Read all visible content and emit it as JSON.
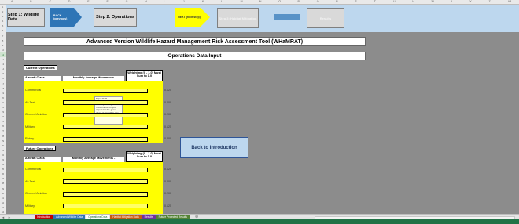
{
  "column_headers": [
    "A",
    "B",
    "C",
    "D",
    "E",
    "F",
    "G",
    "H",
    "I",
    "J",
    "K",
    "L",
    "M",
    "N",
    "O",
    "P",
    "Q",
    "R",
    "S",
    "T",
    "U",
    "V",
    "W",
    "X",
    "Y",
    "Z",
    "AA"
  ],
  "row_numbers": [
    "1",
    "2",
    "3",
    "4",
    "5",
    "6",
    "7",
    "8",
    "9",
    "10",
    "11",
    "12",
    "13",
    "14",
    "15",
    "16",
    "17",
    "18",
    "19",
    "20",
    "21",
    "22",
    "23",
    "24",
    "25",
    "26",
    "27",
    "28",
    "29",
    "30",
    "31",
    "32",
    "33",
    "34",
    "35",
    "36",
    "37",
    "38",
    "39",
    "40",
    "41",
    "42",
    "43",
    "44"
  ],
  "nav": {
    "step1": "Step 1: Wildlife Data",
    "back_arrow": "BACK (previous)",
    "step2": "Step 2: Operations",
    "next_arrow": "NEXT (next step)",
    "step3": "Step 3: Habitat Mitigation",
    "results": "Results",
    "colors": {
      "band": "#bdd7ee",
      "back_arrow": "#2e75b6",
      "next_arrow": "#ffff00"
    }
  },
  "title": "Advanced Version Wildlife Hazard Management Risk Assessment Tool (WHaMRAT)",
  "subtitle": "Operations Data Input",
  "current": {
    "label": "Current Operations",
    "col_class": "Aircraft Class",
    "col_movements": "Monthly Average Movements",
    "col_weight": "Weighting (0 - 1.0) Must Sum to 1.0",
    "rows": [
      {
        "cls": "Commercial",
        "weight": "0.125"
      },
      {
        "cls": "Air Taxi",
        "weight": "0.200"
      },
      {
        "cls": "General Aviation",
        "weight": "0.200"
      },
      {
        "cls": "Military",
        "weight": "0.125"
      },
      {
        "cls": "Rotary",
        "weight": "0.200"
      }
    ]
  },
  "future": {
    "label": "Future Operations",
    "col_class": "Aircraft Class",
    "col_movements": "Monthly Average Movements -",
    "col_weight": "Weighting (0 - 1.0) Must Sum to 1.0",
    "rows": [
      {
        "cls": "Commercial",
        "weight": "0.125"
      },
      {
        "cls": "Air Taxi",
        "weight": "0.200"
      },
      {
        "cls": "General Aviation",
        "weight": "0.200"
      },
      {
        "cls": "Military",
        "weight": "0.125"
      }
    ]
  },
  "tooltip": {
    "title": "Input Cell",
    "body": "Enter the number of monthly average movements for your airport for the given class of aircraft in this cell."
  },
  "back_to_intro": "Back to Introduction",
  "tabs": [
    {
      "label": "Introduction",
      "color": "#c00000"
    },
    {
      "label": "Advanced Wildlife Data",
      "color": "#2e75b6"
    },
    {
      "label": "Operations Data",
      "color": "#ffffff",
      "active": true
    },
    {
      "label": "Habitat Mitigation Data",
      "color": "#c55a11"
    },
    {
      "label": "Results",
      "color": "#7030a0"
    },
    {
      "label": "Future Projected Results",
      "color": "#548235"
    }
  ],
  "sheet_nav": {
    "prev": "◄",
    "next": "►",
    "add": "⊕"
  }
}
